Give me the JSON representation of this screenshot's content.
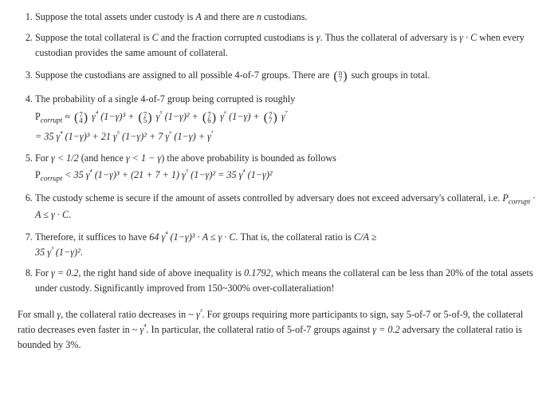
{
  "items": {
    "i1": "Suppose the total assets under custody is $A$ and there are $n$ custodians.",
    "i2": "Suppose the total collateral is $C$ and the fraction corrupted custodians is $γ$. Thus the collateral of adversary is $γ · C$ when every custodian provides the same amount of collateral.",
    "i3_a": "Suppose the custodians are assigned to all possible 4-of-7 groups. There are ",
    "i3_b": " such groups in total.",
    "i4_a": "The probability of a single 4-of-7 group being corrupted is roughly",
    "i4_f1": "P_corrupt ≈ C(7,4) γ⁴ (1−γ)³ + C(7,5) γ⁵ (1−γ)² + C(7,6) γ⁶ (1−γ) + C(7,7) γ⁷",
    "i4_f2": "= 35 γ⁴ (1−γ)³ + 21 γ⁵ (1−γ)² + 7 γ⁶ (1−γ) + γ⁷",
    "i5_a": "For $γ < 1/2$ (and hence $γ < 1 − γ$) the above probability is bounded as follows",
    "i5_f": "P_corrupt < 35 γ⁴ (1−γ)³ + (21 + 7 + 1) γ⁵ (1−γ)² = 35 γ⁴ (1−γ)²",
    "i6": "The custody scheme is secure if the amount of assets controlled by adversary does not exceed adversary's collateral, i.e. $P_corrupt · A ≤ γ · C$.",
    "i7_a": "Therefore, it suffices to have $64 γ⁴ (1−γ)³ · A ≤ γ · C$. That is, the collateral ratio is $C/A ≥$",
    "i7_b": "$35 γ³ (1−γ)²$.",
    "i8": "For $γ = 0.2$, the right hand side of above inequality is $0.1792$, which means the collateral can be less than 20% of the total assets under custody. Significantly improved from 150~300% over-collateraliation!"
  },
  "note": "For small $γ$, the collateral ratio decreases in ~ $γ³$. For groups requiring more participants to sign, say 5-of-7 or 5-of-9, the collateral ratio decreases even faster in ~ $γ⁴$. In particular, the collateral ratio of 5-of-7 groups against $γ = 0.2$ adversary the collateral ratio is bounded by 3%.",
  "binom": {
    "top": "n",
    "bot": "7"
  },
  "chart_data": {
    "type": "table",
    "description": "Derivation bounding a 4-of-7 threshold custody scheme's required collateral ratio.",
    "variables": {
      "A": "total assets under custody",
      "n": "number of custodians",
      "C": "total collateral",
      "gamma": "fraction of corrupted custodians"
    },
    "p_corrupt_expansion": {
      "terms": [
        {
          "coef_binom": [
            7,
            4
          ],
          "gamma_pow": 4,
          "one_minus_gamma_pow": 3,
          "coef_value": 35
        },
        {
          "coef_binom": [
            7,
            5
          ],
          "gamma_pow": 5,
          "one_minus_gamma_pow": 2,
          "coef_value": 21
        },
        {
          "coef_binom": [
            7,
            6
          ],
          "gamma_pow": 6,
          "one_minus_gamma_pow": 1,
          "coef_value": 7
        },
        {
          "coef_binom": [
            7,
            7
          ],
          "gamma_pow": 7,
          "one_minus_gamma_pow": 0,
          "coef_value": 1
        }
      ]
    },
    "bound_condition": "gamma < 1/2",
    "p_corrupt_bound": "35 * gamma^4 * (1-gamma)^2",
    "security_condition": "P_corrupt * A <= gamma * C",
    "sufficient_condition": "64 * gamma^4 * (1-gamma)^3 * A <= gamma * C",
    "collateral_ratio_bound": "C/A >= 35 * gamma^3 * (1-gamma)^2",
    "example": {
      "gamma": 0.2,
      "rhs_value": 0.1792,
      "interpretation": "collateral < 20% of assets"
    },
    "scaling": {
      "4_of_7": "~ gamma^3",
      "5_of_7_or_5_of_9": "~ gamma^4",
      "5_of_7_at_gamma_0.2": "bounded by 3%"
    }
  }
}
